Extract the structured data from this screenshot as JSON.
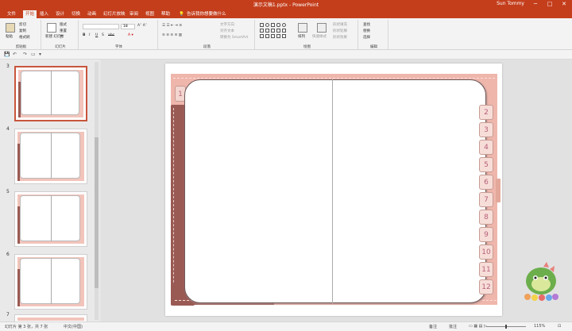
{
  "app": {
    "document_title": "演示文稿1.pptx  -  PowerPoint",
    "user": "Sun Tommy",
    "window_buttons": [
      "─",
      "□",
      "✕"
    ]
  },
  "ribbon_tabs": [
    "文件",
    "开始",
    "插入",
    "设计",
    "切换",
    "动画",
    "幻灯片放映",
    "审阅",
    "视图",
    "帮助"
  ],
  "active_tab": "开始",
  "tell_me": "告诉我你想要做什么",
  "ribbon": {
    "clipboard": {
      "paste": "粘贴",
      "cut": "剪切",
      "copy": "复制",
      "format_painter": "格式刷",
      "label": "剪贴板"
    },
    "slides": {
      "new_slide": "新建\n幻灯片",
      "layout": "版式",
      "reset": "重置",
      "section": "节",
      "label": "幻灯片"
    },
    "font": {
      "font_name": "",
      "font_size": "18",
      "bold": "B",
      "italic": "I",
      "underline": "U",
      "shadow": "S",
      "strike": "abc",
      "label": "字体"
    },
    "paragraph": {
      "text_direction": "文字方向",
      "align_text": "对齐文本",
      "smartart": "转换为 SmartArt",
      "label": "段落"
    },
    "drawing": {
      "arrange": "排列",
      "quick_styles": "快速样式",
      "shape_fill": "形状填充",
      "shape_outline": "形状轮廓",
      "shape_effects": "形状效果",
      "label": "绘图"
    },
    "editing": {
      "find": "查找",
      "replace": "替换",
      "select": "选择",
      "label": "编辑"
    }
  },
  "qat": [
    "💾",
    "↶",
    "↷",
    "▭",
    "▾"
  ],
  "thumbnails": [
    {
      "num": "3",
      "selected": true
    },
    {
      "num": "4",
      "selected": false
    },
    {
      "num": "5",
      "selected": false
    },
    {
      "num": "6",
      "selected": false
    },
    {
      "num": "7",
      "selected": false
    }
  ],
  "slide": {
    "left_tab": "1",
    "right_tabs": [
      "2",
      "3",
      "4",
      "5",
      "6",
      "7",
      "8",
      "9",
      "10",
      "11",
      "12"
    ]
  },
  "status": {
    "slide_info": "幻灯片 第 3 张，共 7 张",
    "language": "中文(中国)",
    "notes": "备注",
    "comments": "批注",
    "zoom": "115%"
  },
  "colors": {
    "accent": "#c43e1c",
    "pink": "#efb6ac",
    "brown": "#9a5a54",
    "tab_text": "#b7607a"
  }
}
